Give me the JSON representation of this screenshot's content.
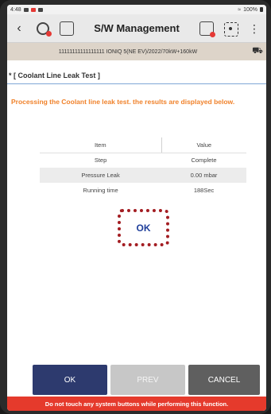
{
  "status_bar": {
    "time": "4:48",
    "battery": "100%"
  },
  "header": {
    "title": "S/W Management",
    "back_icon": "chevron-left-icon",
    "more_icon": "more-vertical-icon"
  },
  "vehicle": {
    "info": "11111111111111111 IONIQ 5(NE EV)/2022/70kW+160kW"
  },
  "section": {
    "title": "* [ Coolant Line Leak Test ]"
  },
  "message": "Processing the Coolant line leak test. the results are displayed below.",
  "results_table": {
    "headers": [
      "Item",
      "Value"
    ],
    "rows": [
      {
        "item": "Step",
        "value": "Complete"
      },
      {
        "item": "Pressure Leak",
        "value": "0.00 mbar"
      },
      {
        "item": "Running time",
        "value": "188Sec"
      }
    ]
  },
  "result_label": "OK",
  "buttons": {
    "ok": "OK",
    "prev": "PREV",
    "cancel": "CANCEL"
  },
  "warning": "Do not touch any system buttons while performing this function.",
  "colors": {
    "message": "#f0822b",
    "highlight_border": "#a31d22",
    "result_text": "#1f3f9b",
    "ok_button": "#2d3a6e",
    "warning_bg": "#e53a2c"
  }
}
